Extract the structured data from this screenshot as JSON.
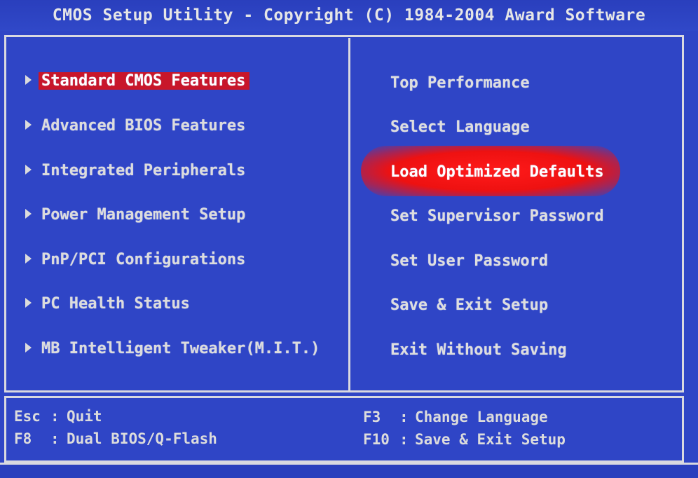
{
  "header": {
    "title": "CMOS Setup Utility - Copyright (C) 1984-2004 Award Software"
  },
  "left_menu": [
    {
      "label": "Standard CMOS Features",
      "selected": true
    },
    {
      "label": "Advanced BIOS Features"
    },
    {
      "label": "Integrated Peripherals"
    },
    {
      "label": "Power Management Setup"
    },
    {
      "label": "PnP/PCI Configurations"
    },
    {
      "label": "PC Health Status"
    },
    {
      "label": "MB Intelligent Tweaker(M.I.T.)"
    }
  ],
  "right_menu": [
    {
      "label": "Top Performance"
    },
    {
      "label": "Select Language"
    },
    {
      "label": "Load Optimized Defaults",
      "highlighted": true
    },
    {
      "label": "Set Supervisor Password"
    },
    {
      "label": "Set User Password"
    },
    {
      "label": "Save & Exit Setup"
    },
    {
      "label": "Exit Without Saving"
    }
  ],
  "help": {
    "esc_key": "Esc",
    "esc_action": "Quit",
    "f8_key": "F8",
    "f8_action": "Dual BIOS/Q-Flash",
    "f3_key": "F3",
    "f3_action": "Change Language",
    "f10_key": "F10",
    "f10_action": "Save & Exit Setup"
  },
  "colors": {
    "background": "#2f45c6",
    "selection": "#c8162a",
    "highlight_glow": "#ee1111",
    "text": "#dcdcdc"
  }
}
